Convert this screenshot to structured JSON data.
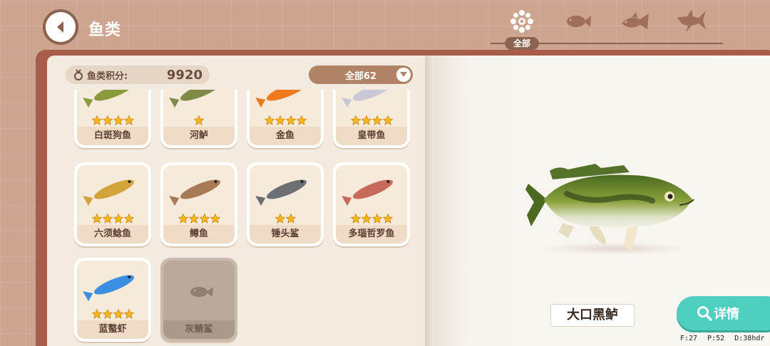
{
  "header": {
    "title": "鱼类"
  },
  "tabs": {
    "active_label": "全部",
    "items": [
      {
        "name": "all",
        "icon": "flower-dots-icon"
      },
      {
        "name": "small",
        "icon": "small-fish-icon"
      },
      {
        "name": "medium",
        "icon": "medium-fish-icon"
      },
      {
        "name": "large",
        "icon": "shark-icon"
      }
    ]
  },
  "score": {
    "label": "鱼类积分:",
    "value": "9920"
  },
  "filter": {
    "label": "全部62"
  },
  "cards": [
    {
      "name": "白斑狗鱼",
      "stars": 4,
      "fish_color": "#8a9a3c",
      "locked": false
    },
    {
      "name": "河鲈",
      "stars": 1,
      "fish_color": "#7f8a48",
      "locked": false
    },
    {
      "name": "金鱼",
      "stars": 4,
      "fish_color": "#ef7a1e",
      "locked": false
    },
    {
      "name": "皇带鱼",
      "stars": 4,
      "fish_color": "#c8c8d6",
      "locked": false
    },
    {
      "name": "六须鲶鱼",
      "stars": 4,
      "fish_color": "#d2a43a",
      "locked": false
    },
    {
      "name": "鳟鱼",
      "stars": 4,
      "fish_color": "#a87a55",
      "locked": false
    },
    {
      "name": "锤头鲨",
      "stars": 2,
      "fish_color": "#6c7075",
      "locked": false
    },
    {
      "name": "多瑙哲罗鱼",
      "stars": 4,
      "fish_color": "#c86a5a",
      "locked": false
    },
    {
      "name": "蓝螯虾",
      "stars": 4,
      "fish_color": "#3c8fe0",
      "locked": false
    },
    {
      "name": "灰鲭鲨",
      "stars": 0,
      "fish_color": "#8f7f73",
      "locked": true
    }
  ],
  "selected_fish": {
    "name": "大口黑鲈"
  },
  "detail_button": {
    "label": "详情"
  },
  "debug": {
    "f": "F:27",
    "p": "P:52",
    "d": "D:38hdr"
  }
}
